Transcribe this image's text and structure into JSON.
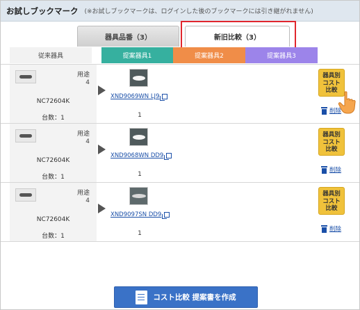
{
  "header": {
    "title": "お試しブックマーク",
    "note": "(※お試しブックマークは、ログインした後のブックマークには引き継がれません)"
  },
  "tabs": [
    {
      "label": "器具品番（3）",
      "active": false
    },
    {
      "label": "新旧比較（3）",
      "active": true
    }
  ],
  "columns": {
    "current": "従来器具",
    "proposal1": "提案器具1",
    "proposal2": "提案器具2",
    "proposal3": "提案器具3"
  },
  "colors": {
    "proposal1": "#36b09f",
    "proposal2": "#f08d48",
    "proposal3": "#9c84ea",
    "cost_button": "#f0c23b",
    "create_button": "#3a72c7",
    "highlight": "#e0262d"
  },
  "rows": [
    {
      "current_model": "NC72604K",
      "usage_label": "用途",
      "usage_value": "4",
      "count_text": "台数：1",
      "proposal_model": "XND9069WN LJ9",
      "proposal_count": "1",
      "cost_button": "器具別\nコスト\n比較",
      "delete_label": "削除"
    },
    {
      "current_model": "NC72604K",
      "usage_label": "用途",
      "usage_value": "4",
      "count_text": "台数：1",
      "proposal_model": "XND9068WN DD9",
      "proposal_count": "1",
      "cost_button": "器具別\nコスト\n比較",
      "delete_label": "削除"
    },
    {
      "current_model": "NC72604K",
      "usage_label": "用途",
      "usage_value": "4",
      "count_text": "台数：1",
      "proposal_model": "XND9097SN DD9",
      "proposal_count": "1",
      "cost_button": "器具別\nコスト\n比較",
      "delete_label": "削除"
    }
  ],
  "footer": {
    "create_button": "コスト比較 提案書を作成"
  },
  "icons": {
    "copy": "copy-icon",
    "trash": "trash-icon",
    "pointer": "hand-pointer-icon",
    "document": "document-icon"
  }
}
